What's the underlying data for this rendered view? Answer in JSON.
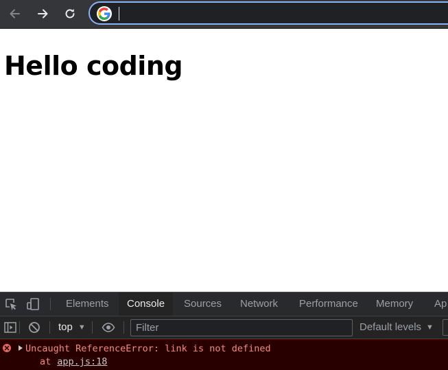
{
  "browser": {
    "back_icon": "arrow-left-icon",
    "forward_icon": "arrow-right-icon",
    "reload_icon": "reload-icon",
    "omnibox_icon": "google-logo-icon",
    "omnibox_value": "",
    "colors": {
      "toolbar": "#35363a",
      "omnibox_focus": "#8ab4f8"
    }
  },
  "page": {
    "heading": "Hello coding"
  },
  "devtools": {
    "tabs": [
      {
        "label": "Elements",
        "active": false
      },
      {
        "label": "Console",
        "active": true
      },
      {
        "label": "Sources",
        "active": false
      },
      {
        "label": "Network",
        "active": false
      },
      {
        "label": "Performance",
        "active": false
      },
      {
        "label": "Memory",
        "active": false
      },
      {
        "label": "Ap",
        "active": false
      }
    ],
    "console_toolbar": {
      "context": "top",
      "filter_placeholder": "Filter",
      "filter_value": "",
      "levels": "Default levels"
    },
    "messages": [
      {
        "level": "error",
        "text": "Uncaught ReferenceError: link is not defined",
        "stack_prefix": "at",
        "source": "app.js:18"
      }
    ],
    "colors": {
      "error_text": "#f28b82",
      "error_bg": "#290000"
    }
  }
}
